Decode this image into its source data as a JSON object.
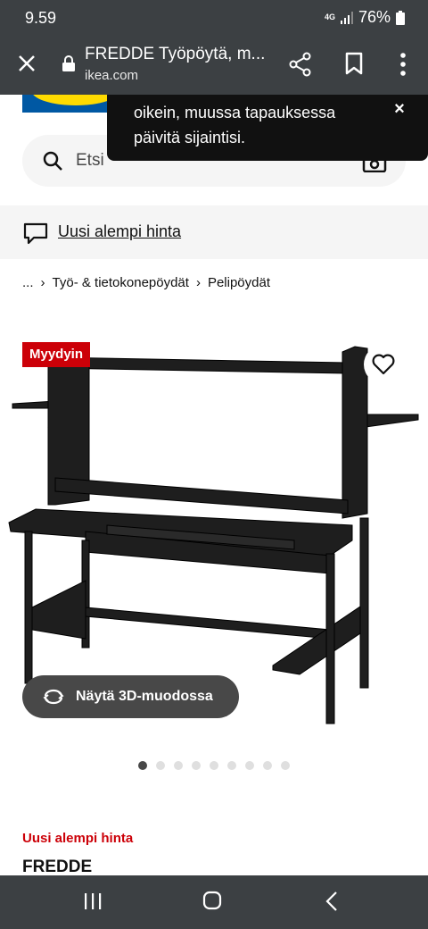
{
  "status_bar": {
    "time": "9.59",
    "network": "4G",
    "battery": "76%"
  },
  "browser": {
    "title": "FREDDE Työpöytä, m...",
    "domain": "ikea.com"
  },
  "toast": {
    "line1": "oikein, muussa tapauksessa",
    "line2": "päivitä sijaintisi.",
    "close": "×"
  },
  "search": {
    "placeholder": "Etsi"
  },
  "promo": {
    "link": "Uusi alempi hinta"
  },
  "breadcrumb": {
    "items": [
      "...",
      "Työ- & tietokonepöydät",
      "Pelipöydät"
    ],
    "separator": "›"
  },
  "product": {
    "badge": "Myydyin",
    "view_3d_label": "Näytä 3D-muodossa",
    "image_count": 9,
    "active_image": 1,
    "price_label": "Uusi alempi hinta",
    "name": "FREDDE"
  },
  "colors": {
    "ikea_blue": "#0058a3",
    "ikea_yellow": "#ffdb00",
    "badge_red": "#cc0008",
    "chrome": "#3c4043"
  }
}
